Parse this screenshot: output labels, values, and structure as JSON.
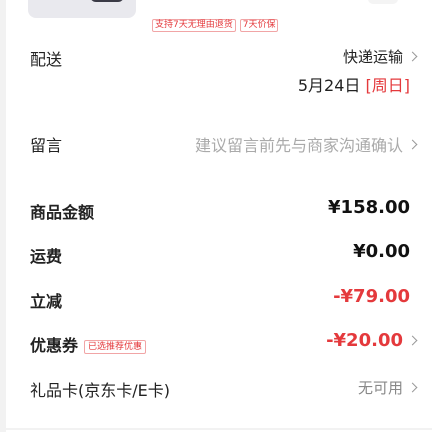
{
  "product": {
    "tags": [
      "支持7天无理由退货",
      "7天价保"
    ]
  },
  "delivery": {
    "label": "配送",
    "method": "快递运输",
    "date": "5月24日",
    "weekday": "[周日]"
  },
  "note": {
    "label": "留言",
    "placeholder": "建议留言前先与商家沟通确认"
  },
  "summary": {
    "goods_amount": {
      "label": "商品金额",
      "value": "¥158.00"
    },
    "shipping": {
      "label": "运费",
      "value": "¥0.00"
    },
    "discount": {
      "label": "立减",
      "value": "-¥79.00"
    },
    "coupon": {
      "label": "优惠券",
      "tag": "已选推荐优惠",
      "value": "-¥20.00"
    },
    "gift_card": {
      "label": "礼品卡(京东卡/E卡)",
      "value": "无可用"
    }
  },
  "colors": {
    "accent_red": "#e4393c",
    "text_dark": "#222222",
    "text_muted": "#aaaaaa",
    "background": "#f2f2f2"
  }
}
